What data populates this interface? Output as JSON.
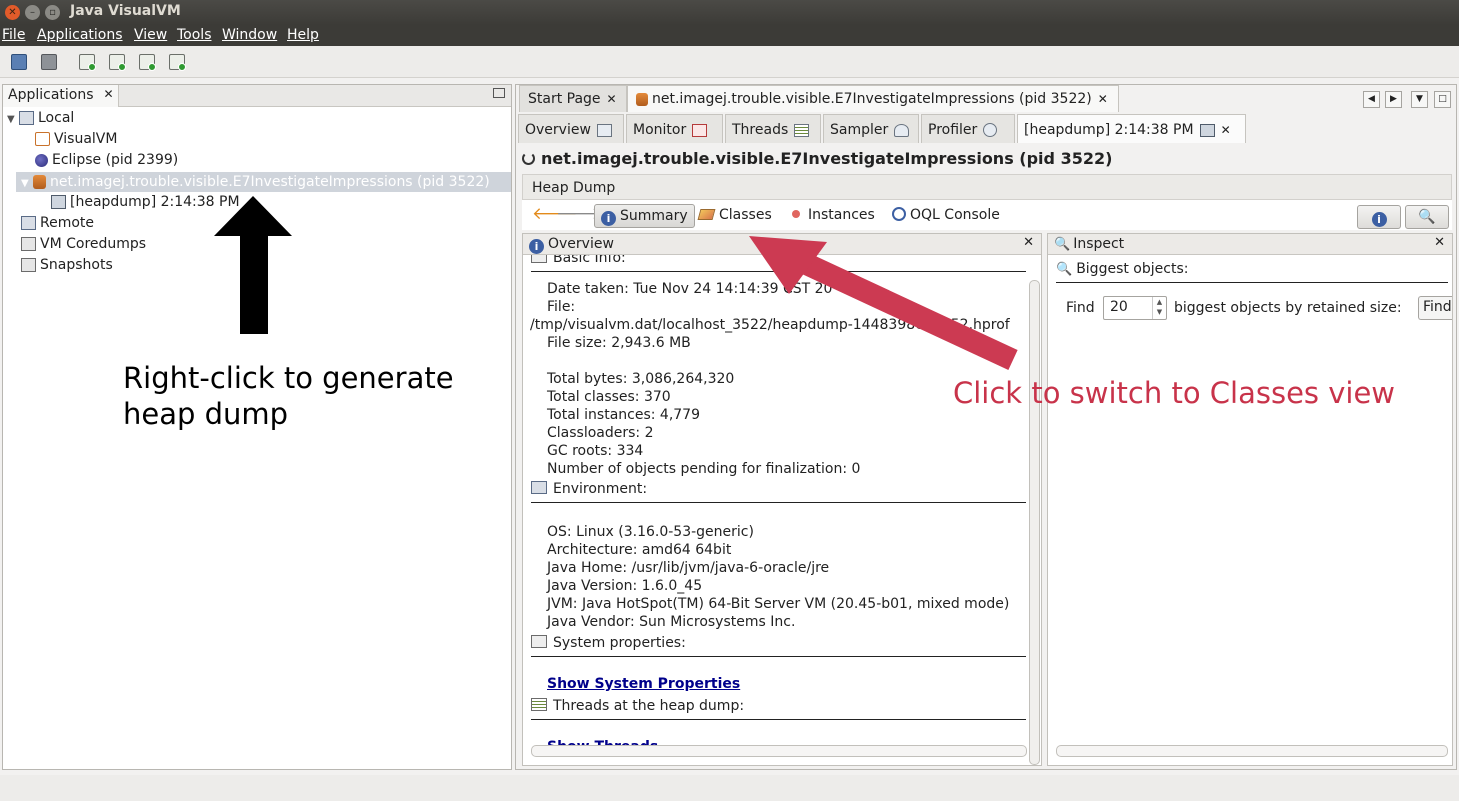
{
  "window": {
    "title": "Java VisualVM"
  },
  "menu": [
    "File",
    "Applications",
    "View",
    "Tools",
    "Window",
    "Help"
  ],
  "toolbar": {
    "icons": [
      "open-icon",
      "save-icon",
      "add-jmx-icon",
      "add-remote-icon",
      "add-coredump-icon",
      "add-snapshot-icon"
    ]
  },
  "left_panel": {
    "tab_label": "Applications",
    "tree": {
      "local": "Local",
      "visualvm": "VisualVM",
      "eclipse": "Eclipse (pid 2399)",
      "app": "net.imagej.trouble.visible.E7InvestigateImpressions (pid 3522)",
      "heapdump": "[heapdump] 2:14:38 PM",
      "remote": "Remote",
      "coredumps": "VM Coredumps",
      "snapshots": "Snapshots"
    }
  },
  "annotations": {
    "left": "Right-click to generate heap dump",
    "right": "Click to switch to Classes view",
    "left_color": "#000000",
    "right_color": "#c8334a"
  },
  "doc_tabs": {
    "start_page": "Start Page",
    "app_tab": "net.imagej.trouble.visible.E7InvestigateImpressions (pid 3522)"
  },
  "sub_tabs": {
    "overview": "Overview",
    "monitor": "Monitor",
    "threads": "Threads",
    "sampler": "Sampler",
    "profiler": "Profiler",
    "heapdump": "[heapdump] 2:14:38 PM"
  },
  "content": {
    "title": "net.imagej.trouble.visible.E7InvestigateImpressions (pid 3522)",
    "heap_dump_label": "Heap Dump",
    "views": {
      "summary": "Summary",
      "classes": "Classes",
      "instances": "Instances",
      "oql": "OQL Console"
    }
  },
  "overview": {
    "header": "Overview",
    "basic_info_header": "Basic Info:",
    "basic_info": {
      "date_taken": "Date taken: Tue Nov 24 14:14:39 CST 20",
      "file_label": "File:",
      "file_path": "/tmp/visualvm.dat/localhost_3522/heapdump-1448398078752.hprof",
      "file_size": "File size: 2,943.6 MB",
      "total_bytes": "Total bytes: 3,086,264,320",
      "total_classes": "Total classes: 370",
      "total_instances": "Total instances: 4,779",
      "classloaders": "Classloaders: 2",
      "gc_roots": "GC roots: 334",
      "pending": "Number of objects pending for finalization: 0"
    },
    "environment_header": "Environment:",
    "environment": {
      "os": "OS: Linux (3.16.0-53-generic)",
      "arch": "Architecture: amd64 64bit",
      "java_home": "Java Home: /usr/lib/jvm/java-6-oracle/jre",
      "java_version": "Java Version: 1.6.0_45",
      "jvm": "JVM: Java HotSpot(TM) 64-Bit Server VM (20.45-b01, mixed mode)",
      "vendor": "Java Vendor: Sun Microsystems Inc."
    },
    "sysprops_header": "System properties:",
    "sysprops_link": "Show System Properties",
    "threads_header": "Threads at the heap dump:",
    "threads_link": "Show Threads"
  },
  "inspect": {
    "header": "Inspect",
    "biggest_header": "Biggest objects:",
    "find_label": "Find",
    "find_value": "20",
    "find_suffix": "biggest objects by retained size:",
    "find_button": "Find"
  }
}
